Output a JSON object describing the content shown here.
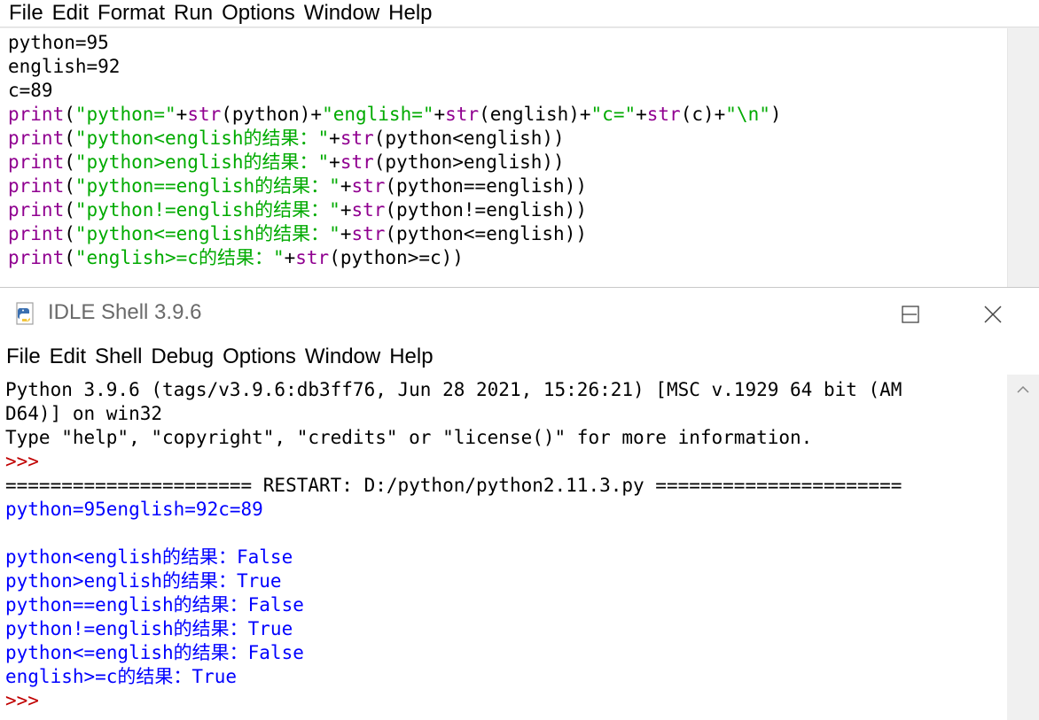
{
  "editor": {
    "menu": [
      "File",
      "Edit",
      "Format",
      "Run",
      "Options",
      "Window",
      "Help"
    ],
    "lines": [
      [
        {
          "t": "python=95",
          "c": ""
        }
      ],
      [
        {
          "t": "english=92",
          "c": ""
        }
      ],
      [
        {
          "t": "c=89",
          "c": ""
        }
      ],
      [
        {
          "t": "print",
          "c": "kw"
        },
        {
          "t": "(",
          "c": ""
        },
        {
          "t": "\"python=\"",
          "c": "st"
        },
        {
          "t": "+",
          "c": ""
        },
        {
          "t": "str",
          "c": "kw"
        },
        {
          "t": "(python)+",
          "c": ""
        },
        {
          "t": "\"english=\"",
          "c": "st"
        },
        {
          "t": "+",
          "c": ""
        },
        {
          "t": "str",
          "c": "kw"
        },
        {
          "t": "(english)+",
          "c": ""
        },
        {
          "t": "\"c=\"",
          "c": "st"
        },
        {
          "t": "+",
          "c": ""
        },
        {
          "t": "str",
          "c": "kw"
        },
        {
          "t": "(c)+",
          "c": ""
        },
        {
          "t": "\"\\n\"",
          "c": "st"
        },
        {
          "t": ")",
          "c": ""
        }
      ],
      [
        {
          "t": "print",
          "c": "kw"
        },
        {
          "t": "(",
          "c": ""
        },
        {
          "t": "\"python<english的结果：\"",
          "c": "st"
        },
        {
          "t": "+",
          "c": ""
        },
        {
          "t": "str",
          "c": "kw"
        },
        {
          "t": "(python<english))",
          "c": ""
        }
      ],
      [
        {
          "t": "print",
          "c": "kw"
        },
        {
          "t": "(",
          "c": ""
        },
        {
          "t": "\"python>english的结果：\"",
          "c": "st"
        },
        {
          "t": "+",
          "c": ""
        },
        {
          "t": "str",
          "c": "kw"
        },
        {
          "t": "(python>english))",
          "c": ""
        }
      ],
      [
        {
          "t": "print",
          "c": "kw"
        },
        {
          "t": "(",
          "c": ""
        },
        {
          "t": "\"python==english的结果：\"",
          "c": "st"
        },
        {
          "t": "+",
          "c": ""
        },
        {
          "t": "str",
          "c": "kw"
        },
        {
          "t": "(python==english))",
          "c": ""
        }
      ],
      [
        {
          "t": "print",
          "c": "kw"
        },
        {
          "t": "(",
          "c": ""
        },
        {
          "t": "\"python!=english的结果：\"",
          "c": "st"
        },
        {
          "t": "+",
          "c": ""
        },
        {
          "t": "str",
          "c": "kw"
        },
        {
          "t": "(python!=english))",
          "c": ""
        }
      ],
      [
        {
          "t": "print",
          "c": "kw"
        },
        {
          "t": "(",
          "c": ""
        },
        {
          "t": "\"python<=english的结果：\"",
          "c": "st"
        },
        {
          "t": "+",
          "c": ""
        },
        {
          "t": "str",
          "c": "kw"
        },
        {
          "t": "(python<=english))",
          "c": ""
        }
      ],
      [
        {
          "t": "print",
          "c": "kw"
        },
        {
          "t": "(",
          "c": ""
        },
        {
          "t": "\"english>=c的结果：\"",
          "c": "st"
        },
        {
          "t": "+",
          "c": ""
        },
        {
          "t": "str",
          "c": "kw"
        },
        {
          "t": "(python>=c))",
          "c": ""
        }
      ]
    ]
  },
  "shell": {
    "title": "IDLE Shell 3.9.6",
    "icon": "python-feather-icon",
    "window_buttons": [
      "minimize-icon",
      "maximize-icon",
      "close-icon"
    ],
    "menu": [
      "File",
      "Edit",
      "Shell",
      "Debug",
      "Options",
      "Window",
      "Help"
    ],
    "lines": [
      [
        {
          "t": "Python 3.9.6 (tags/v3.9.6:db3ff76, Jun 28 2021, 15:26:21) [MSC v.1929 64 bit (AM",
          "c": ""
        }
      ],
      [
        {
          "t": "D64)] on win32",
          "c": ""
        }
      ],
      [
        {
          "t": "Type \"help\", \"copyright\", \"credits\" or \"license()\" for more information.",
          "c": ""
        }
      ],
      [
        {
          "t": ">>>",
          "c": "prompt"
        }
      ],
      [
        {
          "t": "====================== RESTART: D:/python/python2.11.3.py ======================",
          "c": ""
        }
      ],
      [
        {
          "t": "python=95english=92c=89",
          "c": "out"
        }
      ],
      [
        {
          "t": "",
          "c": ""
        }
      ],
      [
        {
          "t": "python<english的结果：False",
          "c": "out"
        }
      ],
      [
        {
          "t": "python>english的结果：True",
          "c": "out"
        }
      ],
      [
        {
          "t": "python==english的结果：False",
          "c": "out"
        }
      ],
      [
        {
          "t": "python!=english的结果：True",
          "c": "out"
        }
      ],
      [
        {
          "t": "python<=english的结果：False",
          "c": "out"
        }
      ],
      [
        {
          "t": "english>=c的结果：True",
          "c": "out"
        }
      ],
      [
        {
          "t": ">>>",
          "c": "prompt"
        }
      ]
    ]
  },
  "colors": {
    "keyword": "#900090",
    "string": "#00aa00",
    "output": "#0000ff",
    "prompt": "#c00000"
  }
}
